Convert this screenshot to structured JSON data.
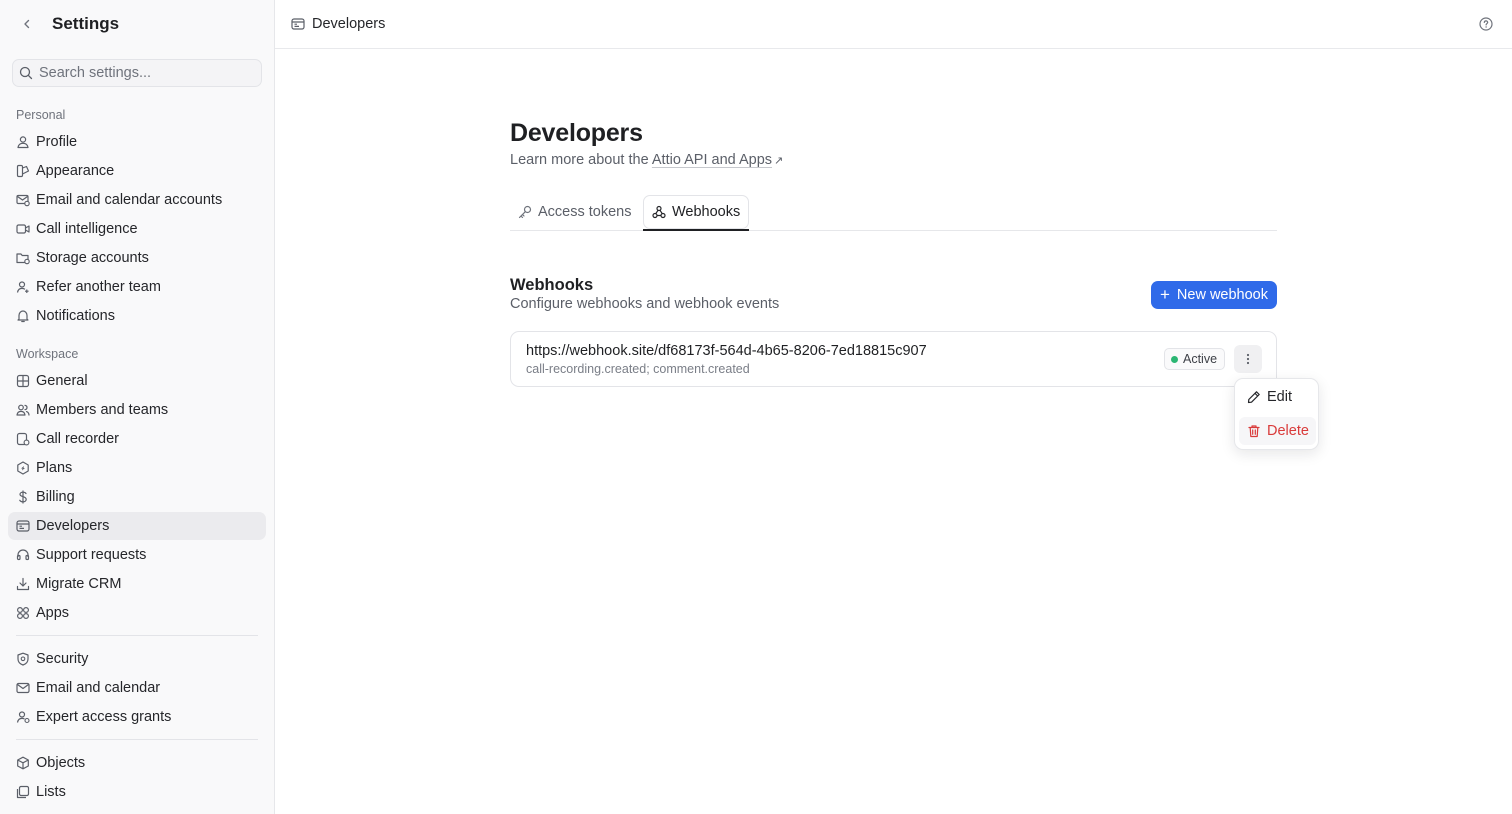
{
  "sidebar": {
    "title": "Settings",
    "search_placeholder": "Search settings...",
    "personal_label": "Personal",
    "workspace_label": "Workspace",
    "personal": [
      "Profile",
      "Appearance",
      "Email and calendar accounts",
      "Call intelligence",
      "Storage accounts",
      "Refer another team",
      "Notifications"
    ],
    "workspace": [
      "General",
      "Members and teams",
      "Call recorder",
      "Plans",
      "Billing",
      "Developers",
      "Support requests",
      "Migrate CRM",
      "Apps"
    ],
    "security": [
      "Security",
      "Email and calendar",
      "Expert access grants"
    ],
    "data": [
      "Objects",
      "Lists"
    ],
    "active": "Developers"
  },
  "topbar": {
    "breadcrumb": "Developers"
  },
  "main": {
    "title": "Developers",
    "subtitle_prefix": "Learn more about the ",
    "subtitle_link": "Attio API and Apps",
    "subtitle_arrow": "↗",
    "tabs": [
      {
        "label": "Access tokens",
        "icon": "key-icon"
      },
      {
        "label": "Webhooks",
        "icon": "webhook-icon",
        "active": true
      }
    ],
    "webhooks": {
      "title": "Webhooks",
      "subtitle": "Configure webhooks and webhook events",
      "new_button": "New webhook",
      "items": [
        {
          "url": "https://webhook.site/df68173f-564d-4b65-8206-7ed18815c907",
          "events": "call-recording.created; comment.created",
          "status": "Active",
          "status_color": "#2bb673"
        }
      ]
    },
    "menu": {
      "edit": "Edit",
      "delete": "Delete",
      "delete_color": "#d93a3a"
    }
  },
  "colors": {
    "accent": "#2f6ae9",
    "active_nav_bg": "#ebebee"
  }
}
